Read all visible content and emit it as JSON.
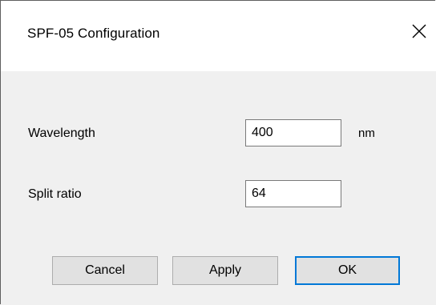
{
  "window": {
    "title": "SPF-05 Configuration",
    "close_icon": "close-icon"
  },
  "form": {
    "wavelength": {
      "label": "Wavelength",
      "value": "400",
      "unit": "nm"
    },
    "split_ratio": {
      "label": "Split ratio",
      "value": "64"
    }
  },
  "buttons": {
    "cancel": "Cancel",
    "apply": "Apply",
    "ok": "OK"
  },
  "colors": {
    "accent": "#0078d7",
    "background": "#f0f0f0",
    "titlebar": "#ffffff"
  }
}
